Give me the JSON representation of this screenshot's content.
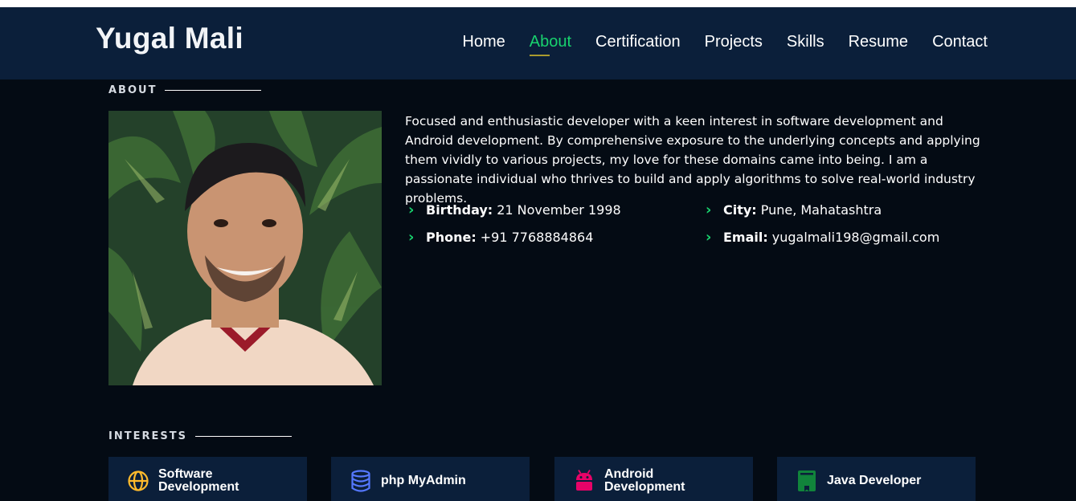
{
  "header": {
    "logo": "Yugal Mali",
    "nav": [
      "Home",
      "About",
      "Certification",
      "Projects",
      "Skills",
      "Resume",
      "Contact"
    ],
    "active_nav": "About",
    "accent": "#18d26e"
  },
  "about": {
    "title": "ABOUT",
    "bio": "Focused and enthusiastic developer with a keen interest in software development and Android development. By comprehensive exposure to the underlying concepts and applying them vividly to various projects, my love for these domains came into being. I am a passionate individual who thrives to build and apply algorithms to solve real-world industry problems.",
    "facts": [
      {
        "key": "Birthday:",
        "value": "21 November 1998"
      },
      {
        "key": "City:",
        "value": "Pune, Mahatashtra"
      },
      {
        "key": "Phone:",
        "value": "+91 7768884864"
      },
      {
        "key": "Email:",
        "value": "yugalmali198@gmail.com"
      }
    ]
  },
  "interests": {
    "title": "INTERESTS",
    "items": [
      {
        "label": "Software Development",
        "icon": "globe-icon",
        "color": "#ffbb2c"
      },
      {
        "label": "php MyAdmin",
        "icon": "database-icon",
        "color": "#5578ff"
      },
      {
        "label": "Android Development",
        "icon": "android-icon",
        "color": "#e80368"
      },
      {
        "label": "Java Developer",
        "icon": "book-icon",
        "color": "#11843b"
      }
    ]
  }
}
